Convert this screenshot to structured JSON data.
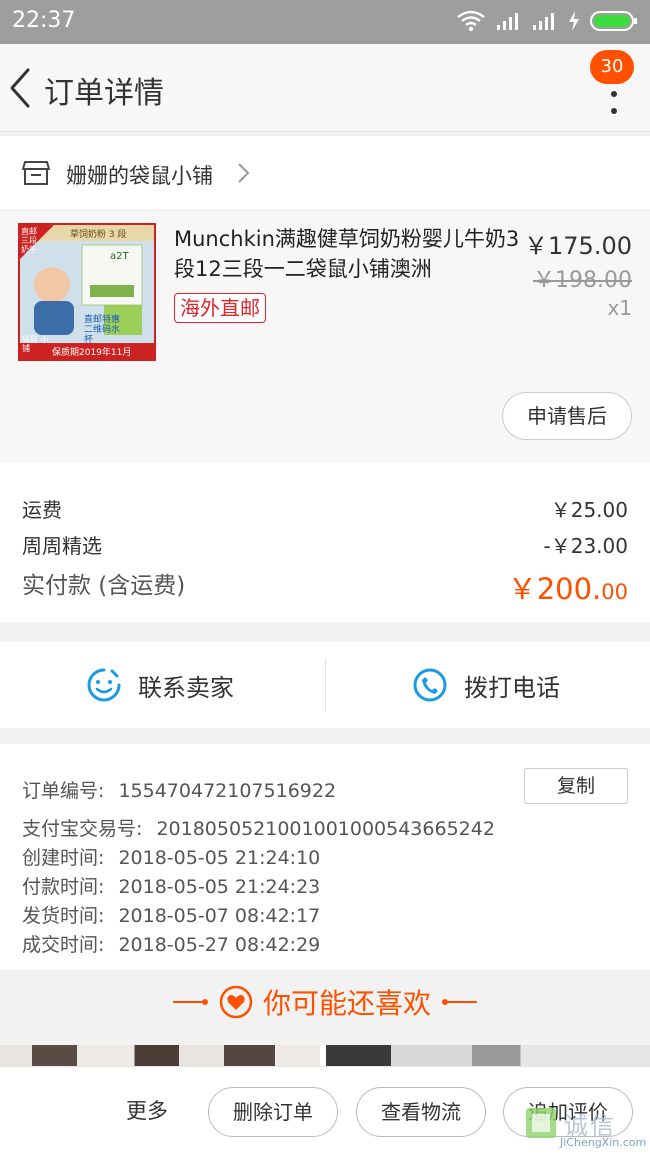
{
  "status_bar": {
    "time": "22:37"
  },
  "header": {
    "title": "订单详情",
    "badge_count": "30"
  },
  "shop": {
    "name": "姗姗的袋鼠小铺"
  },
  "product": {
    "title": "Munchkin满趣健草饲奶粉婴儿牛奶3段12三段一二袋鼠小铺澳洲",
    "price": "￥175.00",
    "original_price": "￥198.00",
    "quantity": "x1",
    "tag": "海外直邮",
    "after_sale_label": "申请售后",
    "image": {
      "corner_text": "直邮 三段奶牛",
      "top_text": "草饲奶粉 3 段",
      "mid_text": "直邮特惠 二维码水杯",
      "shop_text": "袋鼠 小铺",
      "expiry_text": "保质期2019年11月",
      "can_label": "a2T"
    }
  },
  "fees": {
    "shipping_label": "运费",
    "shipping_value": "￥25.00",
    "discount_label": "周周精选",
    "discount_value": "-￥23.00",
    "total_label": "实付款 (含运费)",
    "total_main": "￥200.",
    "total_cents": "00"
  },
  "contact": {
    "seller_label": "联系卖家",
    "phone_label": "拨打电话"
  },
  "order_info": {
    "order_no_label": "订单编号:",
    "order_no_value": "1554704721075169​22",
    "copy_label": "复制",
    "alipay_label": "支付宝交易号:",
    "alipay_value": "2018050521001001000543665242",
    "created_label": "创建时间:",
    "created_value": "2018-05-05 21:24:10",
    "paid_label": "付款时间:",
    "paid_value": "2018-05-05 21:24:23",
    "shipped_label": "发货时间:",
    "shipped_value": "2018-05-07 08:42:17",
    "completed_label": "成交时间:",
    "completed_value": "2018-05-27 08:42:29"
  },
  "recommend": {
    "title": "你可能还喜欢"
  },
  "bottom_bar": {
    "more_label": "更多",
    "delete_label": "删除订单",
    "logistics_label": "查看物流",
    "review_label": "追加评价"
  },
  "watermark": {
    "text": "诚信",
    "url": "JiChengXin.com"
  },
  "colors": {
    "accent": "#ff5000",
    "tag_red": "#e0242b",
    "icon_blue": "#1a9be3"
  },
  "icons": [
    "back-arrow-icon",
    "more-dots-icon",
    "shop-icon",
    "chevron-right-icon",
    "smile-chat-icon",
    "phone-icon",
    "heart-icon",
    "wifi-icon",
    "signal-icon",
    "battery-icon"
  ]
}
